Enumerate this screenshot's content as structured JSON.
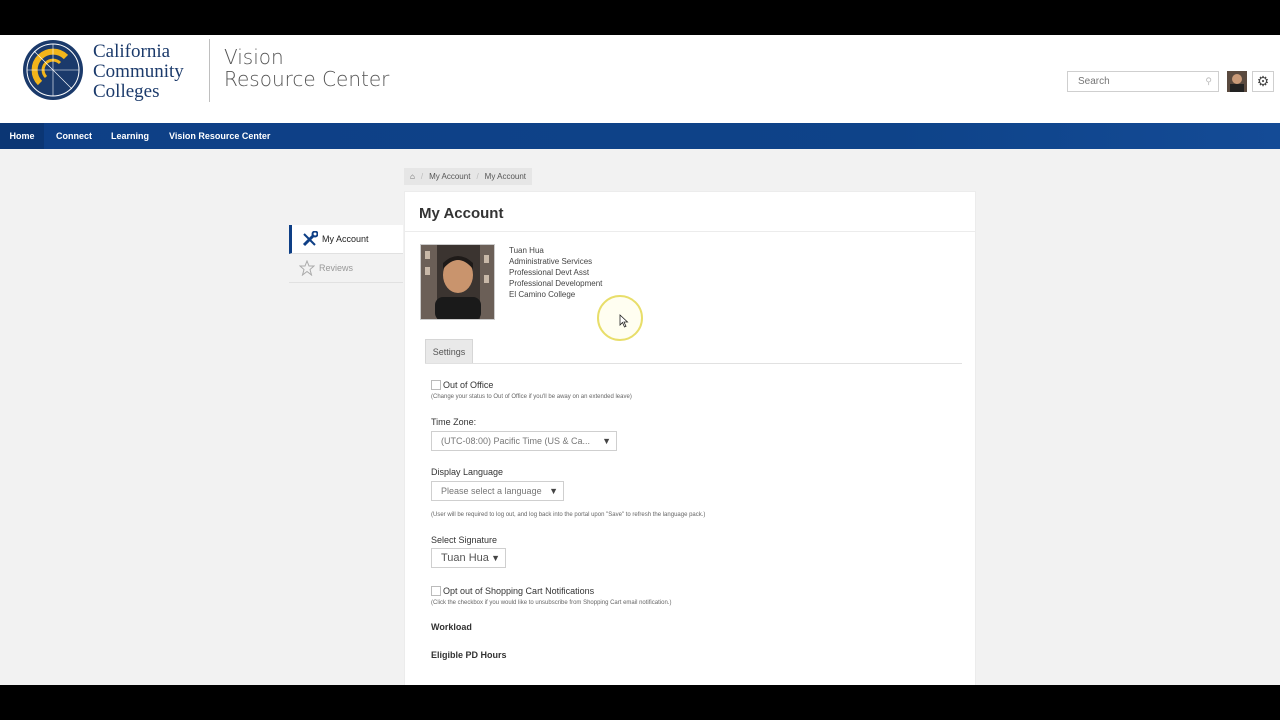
{
  "header": {
    "org_line1": "California",
    "org_line2": "Community",
    "org_line3": "Colleges",
    "vrc_line1": "Vision",
    "vrc_line2": "Resource Center",
    "search_placeholder": "Search"
  },
  "nav": {
    "items": [
      "Home",
      "Connect",
      "Learning",
      "Vision Resource Center"
    ]
  },
  "breadcrumb": [
    "My Account",
    "My Account"
  ],
  "sidebar": {
    "items": [
      {
        "label": "My Account",
        "icon": "wrench-screwdriver-icon"
      },
      {
        "label": "Reviews",
        "icon": "star-icon"
      }
    ]
  },
  "page": {
    "title": "My Account",
    "profile": {
      "name": "Tuan Hua",
      "line2": "Administrative Services",
      "line3": "Professional Devt Asst",
      "line4": "Professional Development",
      "line5": "El Camino College"
    },
    "tab": "Settings",
    "form": {
      "out_of_office_label": "Out of Office",
      "out_of_office_hint": "(Change your status to Out of Office if you'll be away on an extended leave)",
      "time_zone_label": "Time Zone:",
      "time_zone_value": "(UTC-08:00) Pacific Time (US & Ca...",
      "display_language_label": "Display Language",
      "display_language_value": "Please select a language",
      "display_language_hint": "(User will be required to log out, and log back into the portal upon \"Save\" to refresh the language pack.)",
      "signature_label": "Select Signature",
      "signature_value": "Tuan Hua",
      "opt_out_label": "Opt out of Shopping Cart Notifications",
      "opt_out_hint": "(Click the checkbox if you would like to unsubscribe from Shopping Cart email notification.)",
      "workload_label": "Workload",
      "eligible_pd_label": "Eligible PD Hours"
    }
  },
  "colors": {
    "nav_blue": "#0e3f86",
    "logo_gold": "#f2b51b",
    "logo_navy": "#1b3a6b"
  }
}
